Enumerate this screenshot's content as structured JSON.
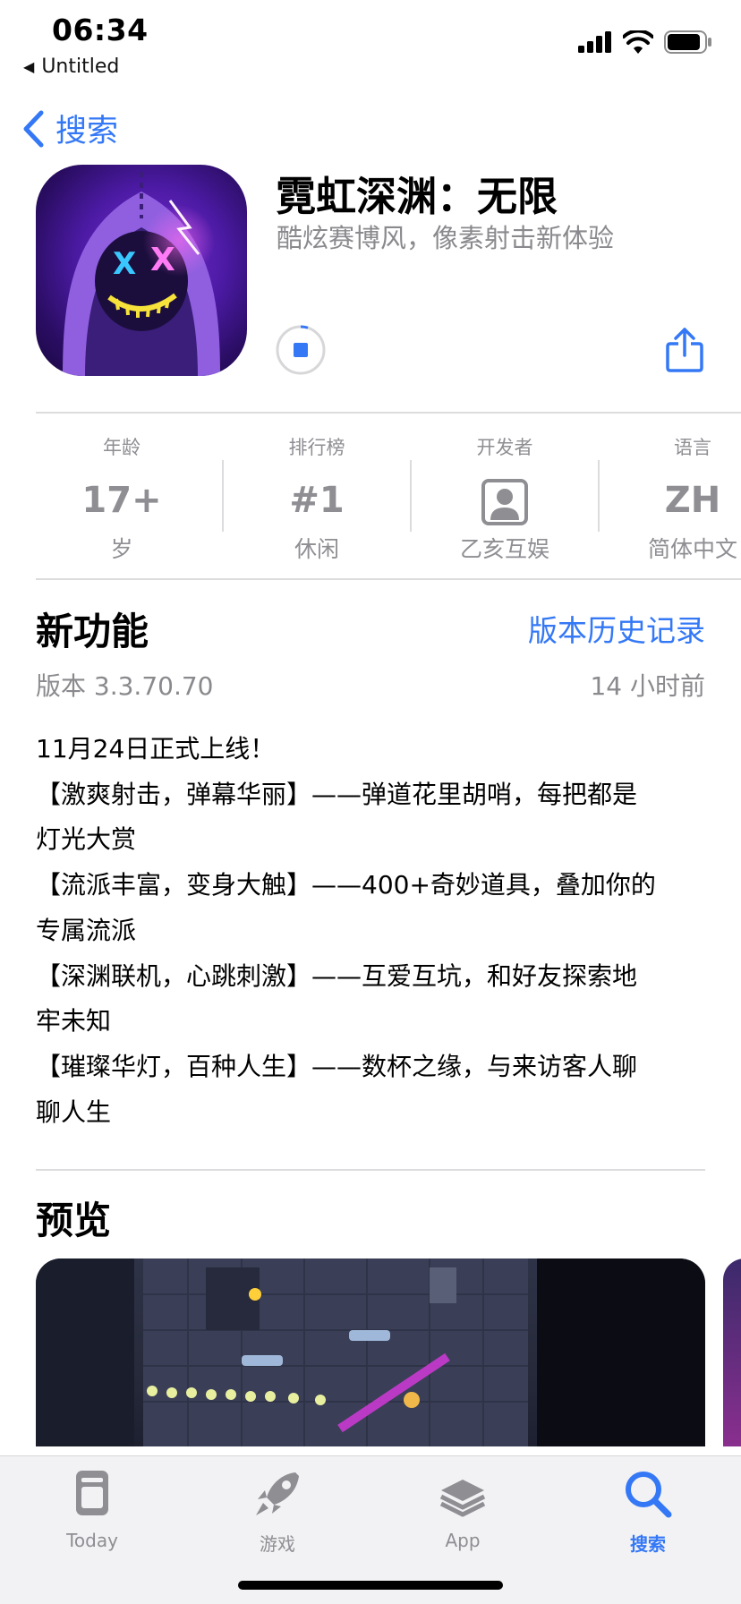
{
  "status_bar": {
    "time": "06:34",
    "back_app": "Untitled"
  },
  "nav": {
    "back_label": "搜索"
  },
  "app": {
    "name": "霓虹深渊：无限",
    "subtitle": "酷炫赛博风，像素射击新体验",
    "download_progress": 0.05
  },
  "info": [
    {
      "label": "年龄",
      "value": "17+",
      "sub": "岁"
    },
    {
      "label": "排行榜",
      "value": "#1",
      "sub": "休闲"
    },
    {
      "label": "开发者",
      "value": "",
      "sub": "乙亥互娱",
      "icon": "developer-person-icon"
    },
    {
      "label": "语言",
      "value": "ZH",
      "sub": "简体中文"
    }
  ],
  "whats_new": {
    "title": "新功能",
    "history_link": "版本历史记录",
    "version": "版本 3.3.70.70",
    "time_ago": "14 小时前",
    "notes": [
      "11月24日正式上线！",
      "【激爽射击，弹幕华丽】——弹道花里胡哨，每把都是",
      "灯光大赏",
      "【流派丰富，变身大触】——400+奇妙道具，叠加你的",
      "专属流派",
      "【深渊联机，心跳刺激】——互爱互坑，和好友探索地",
      "牢未知",
      "【璀璨华灯，百种人生】——数杯之缘，与来访客人聊",
      "聊人生"
    ]
  },
  "preview": {
    "title": "预览"
  },
  "tabbar": {
    "items": [
      {
        "label": "Today",
        "icon": "today-icon",
        "active": false
      },
      {
        "label": "游戏",
        "icon": "rocket-icon",
        "active": false
      },
      {
        "label": "App",
        "icon": "app-stack-icon",
        "active": false
      },
      {
        "label": "搜索",
        "icon": "search-icon",
        "active": true
      }
    ]
  },
  "colors": {
    "accent": "#3478f6",
    "secondary_text": "#8a8a8e",
    "separator": "#dcdcde"
  }
}
